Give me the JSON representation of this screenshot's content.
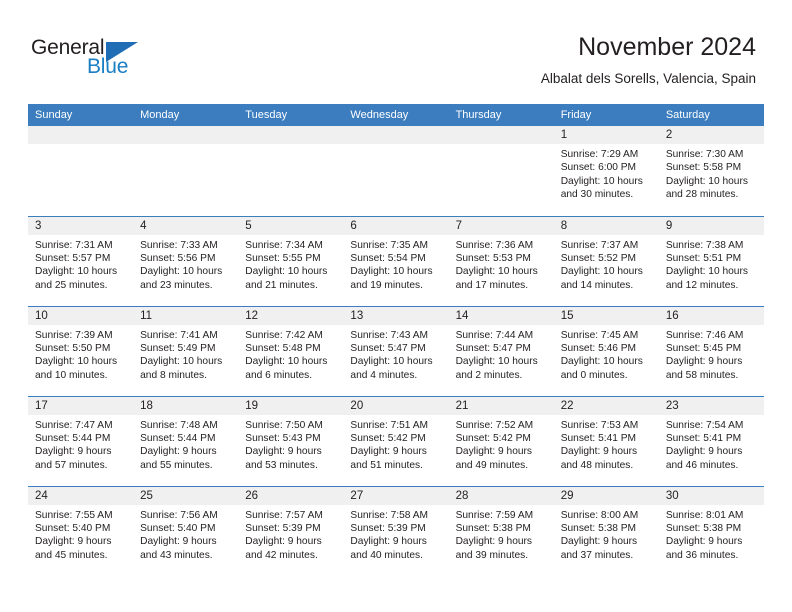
{
  "brand": {
    "name_top": "General",
    "name_bottom": "Blue",
    "triangle_color": "#1f6eb5",
    "text_color": "#231f20",
    "blue_color": "#1b7fc4"
  },
  "header": {
    "title": "November 2024",
    "subtitle": "Albalat dels Sorells, Valencia, Spain"
  },
  "theme": {
    "header_bg": "#3b7dbf",
    "header_text": "#ffffff",
    "daynum_band_bg": "#f0f0f0",
    "row_divider": "#3b7dbf",
    "page_bg": "#ffffff"
  },
  "calendar": {
    "weekday_headers": [
      "Sunday",
      "Monday",
      "Tuesday",
      "Wednesday",
      "Thursday",
      "Friday",
      "Saturday"
    ],
    "weeks": [
      [
        {
          "day": "",
          "empty": true,
          "lines": []
        },
        {
          "day": "",
          "empty": true,
          "lines": []
        },
        {
          "day": "",
          "empty": true,
          "lines": []
        },
        {
          "day": "",
          "empty": true,
          "lines": []
        },
        {
          "day": "",
          "empty": true,
          "lines": []
        },
        {
          "day": "1",
          "empty": false,
          "lines": [
            "Sunrise: 7:29 AM",
            "Sunset: 6:00 PM",
            "Daylight: 10 hours",
            "and 30 minutes."
          ]
        },
        {
          "day": "2",
          "empty": false,
          "lines": [
            "Sunrise: 7:30 AM",
            "Sunset: 5:58 PM",
            "Daylight: 10 hours",
            "and 28 minutes."
          ]
        }
      ],
      [
        {
          "day": "3",
          "empty": false,
          "lines": [
            "Sunrise: 7:31 AM",
            "Sunset: 5:57 PM",
            "Daylight: 10 hours",
            "and 25 minutes."
          ]
        },
        {
          "day": "4",
          "empty": false,
          "lines": [
            "Sunrise: 7:33 AM",
            "Sunset: 5:56 PM",
            "Daylight: 10 hours",
            "and 23 minutes."
          ]
        },
        {
          "day": "5",
          "empty": false,
          "lines": [
            "Sunrise: 7:34 AM",
            "Sunset: 5:55 PM",
            "Daylight: 10 hours",
            "and 21 minutes."
          ]
        },
        {
          "day": "6",
          "empty": false,
          "lines": [
            "Sunrise: 7:35 AM",
            "Sunset: 5:54 PM",
            "Daylight: 10 hours",
            "and 19 minutes."
          ]
        },
        {
          "day": "7",
          "empty": false,
          "lines": [
            "Sunrise: 7:36 AM",
            "Sunset: 5:53 PM",
            "Daylight: 10 hours",
            "and 17 minutes."
          ]
        },
        {
          "day": "8",
          "empty": false,
          "lines": [
            "Sunrise: 7:37 AM",
            "Sunset: 5:52 PM",
            "Daylight: 10 hours",
            "and 14 minutes."
          ]
        },
        {
          "day": "9",
          "empty": false,
          "lines": [
            "Sunrise: 7:38 AM",
            "Sunset: 5:51 PM",
            "Daylight: 10 hours",
            "and 12 minutes."
          ]
        }
      ],
      [
        {
          "day": "10",
          "empty": false,
          "lines": [
            "Sunrise: 7:39 AM",
            "Sunset: 5:50 PM",
            "Daylight: 10 hours",
            "and 10 minutes."
          ]
        },
        {
          "day": "11",
          "empty": false,
          "lines": [
            "Sunrise: 7:41 AM",
            "Sunset: 5:49 PM",
            "Daylight: 10 hours",
            "and 8 minutes."
          ]
        },
        {
          "day": "12",
          "empty": false,
          "lines": [
            "Sunrise: 7:42 AM",
            "Sunset: 5:48 PM",
            "Daylight: 10 hours",
            "and 6 minutes."
          ]
        },
        {
          "day": "13",
          "empty": false,
          "lines": [
            "Sunrise: 7:43 AM",
            "Sunset: 5:47 PM",
            "Daylight: 10 hours",
            "and 4 minutes."
          ]
        },
        {
          "day": "14",
          "empty": false,
          "lines": [
            "Sunrise: 7:44 AM",
            "Sunset: 5:47 PM",
            "Daylight: 10 hours",
            "and 2 minutes."
          ]
        },
        {
          "day": "15",
          "empty": false,
          "lines": [
            "Sunrise: 7:45 AM",
            "Sunset: 5:46 PM",
            "Daylight: 10 hours",
            "and 0 minutes."
          ]
        },
        {
          "day": "16",
          "empty": false,
          "lines": [
            "Sunrise: 7:46 AM",
            "Sunset: 5:45 PM",
            "Daylight: 9 hours",
            "and 58 minutes."
          ]
        }
      ],
      [
        {
          "day": "17",
          "empty": false,
          "lines": [
            "Sunrise: 7:47 AM",
            "Sunset: 5:44 PM",
            "Daylight: 9 hours",
            "and 57 minutes."
          ]
        },
        {
          "day": "18",
          "empty": false,
          "lines": [
            "Sunrise: 7:48 AM",
            "Sunset: 5:44 PM",
            "Daylight: 9 hours",
            "and 55 minutes."
          ]
        },
        {
          "day": "19",
          "empty": false,
          "lines": [
            "Sunrise: 7:50 AM",
            "Sunset: 5:43 PM",
            "Daylight: 9 hours",
            "and 53 minutes."
          ]
        },
        {
          "day": "20",
          "empty": false,
          "lines": [
            "Sunrise: 7:51 AM",
            "Sunset: 5:42 PM",
            "Daylight: 9 hours",
            "and 51 minutes."
          ]
        },
        {
          "day": "21",
          "empty": false,
          "lines": [
            "Sunrise: 7:52 AM",
            "Sunset: 5:42 PM",
            "Daylight: 9 hours",
            "and 49 minutes."
          ]
        },
        {
          "day": "22",
          "empty": false,
          "lines": [
            "Sunrise: 7:53 AM",
            "Sunset: 5:41 PM",
            "Daylight: 9 hours",
            "and 48 minutes."
          ]
        },
        {
          "day": "23",
          "empty": false,
          "lines": [
            "Sunrise: 7:54 AM",
            "Sunset: 5:41 PM",
            "Daylight: 9 hours",
            "and 46 minutes."
          ]
        }
      ],
      [
        {
          "day": "24",
          "empty": false,
          "lines": [
            "Sunrise: 7:55 AM",
            "Sunset: 5:40 PM",
            "Daylight: 9 hours",
            "and 45 minutes."
          ]
        },
        {
          "day": "25",
          "empty": false,
          "lines": [
            "Sunrise: 7:56 AM",
            "Sunset: 5:40 PM",
            "Daylight: 9 hours",
            "and 43 minutes."
          ]
        },
        {
          "day": "26",
          "empty": false,
          "lines": [
            "Sunrise: 7:57 AM",
            "Sunset: 5:39 PM",
            "Daylight: 9 hours",
            "and 42 minutes."
          ]
        },
        {
          "day": "27",
          "empty": false,
          "lines": [
            "Sunrise: 7:58 AM",
            "Sunset: 5:39 PM",
            "Daylight: 9 hours",
            "and 40 minutes."
          ]
        },
        {
          "day": "28",
          "empty": false,
          "lines": [
            "Sunrise: 7:59 AM",
            "Sunset: 5:38 PM",
            "Daylight: 9 hours",
            "and 39 minutes."
          ]
        },
        {
          "day": "29",
          "empty": false,
          "lines": [
            "Sunrise: 8:00 AM",
            "Sunset: 5:38 PM",
            "Daylight: 9 hours",
            "and 37 minutes."
          ]
        },
        {
          "day": "30",
          "empty": false,
          "lines": [
            "Sunrise: 8:01 AM",
            "Sunset: 5:38 PM",
            "Daylight: 9 hours",
            "and 36 minutes."
          ]
        }
      ]
    ]
  }
}
